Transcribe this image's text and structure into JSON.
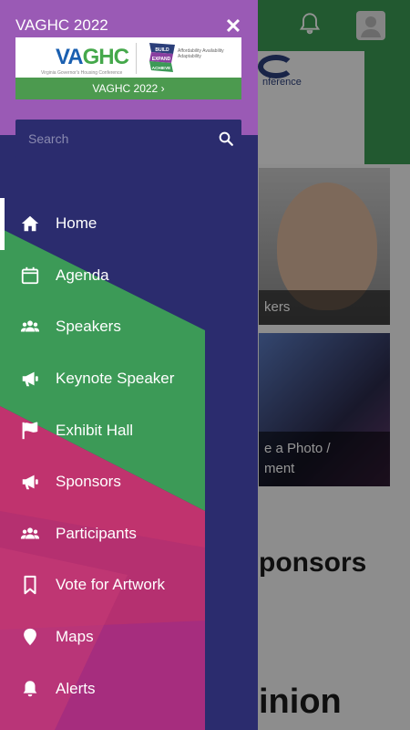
{
  "drawer": {
    "title": "VAGHC 2022",
    "close_glyph": "✕",
    "banner": {
      "logo_text_a": "VA",
      "logo_text_b": "GHC",
      "logo_subtitle": "Virginia Governor's Housing Conference",
      "partner_mark": "BUILD EXPAND ACHIEVE",
      "partner_lines": "Affordability Availability Adaptability",
      "cta_label": "VAGHC 2022 ›"
    },
    "search": {
      "placeholder": "Search",
      "value": ""
    },
    "items": [
      {
        "label": "Home",
        "icon": "home-icon",
        "active": true
      },
      {
        "label": "Agenda",
        "icon": "calendar-icon",
        "active": false
      },
      {
        "label": "Speakers",
        "icon": "people-icon",
        "active": false
      },
      {
        "label": "Keynote Speaker",
        "icon": "megaphone-icon",
        "active": false
      },
      {
        "label": "Exhibit Hall",
        "icon": "flag-icon",
        "active": false
      },
      {
        "label": "Sponsors",
        "icon": "megaphone-icon",
        "active": false
      },
      {
        "label": "Participants",
        "icon": "people-icon",
        "active": false
      },
      {
        "label": "Vote for Artwork",
        "icon": "bookmark-icon",
        "active": false
      },
      {
        "label": "Maps",
        "icon": "map-pin-icon",
        "active": false
      },
      {
        "label": "Alerts",
        "icon": "bell-icon",
        "active": false
      }
    ]
  },
  "background": {
    "hero_text": "nference",
    "card_speakers_label": "kers",
    "card_photo_label_1": "e a Photo /",
    "card_photo_label_2": "ment",
    "sponsors_title": "ponsors",
    "opinion_title": "inion"
  },
  "colors": {
    "header_purple": "#9a5ab5",
    "drawer_navy": "#2b2c6e",
    "band_green": "#3c9a57",
    "band_pink": "#c0336e",
    "band_magenta": "#b0307e",
    "cta_green": "#4c9a4f"
  }
}
